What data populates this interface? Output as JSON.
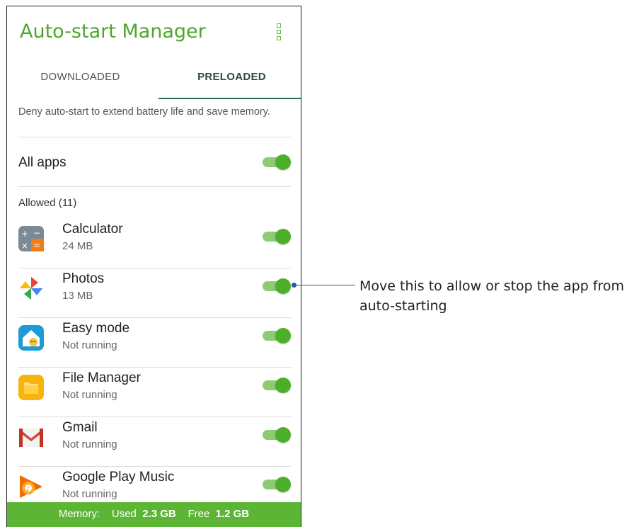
{
  "header": {
    "title": "Auto-start Manager",
    "menu_icon": "overflow-menu-icon"
  },
  "tabs": [
    {
      "label": "DOWNLOADED",
      "selected": false
    },
    {
      "label": "PRELOADED",
      "selected": true
    }
  ],
  "description": "Deny auto-start to extend battery life and save memory.",
  "all_apps": {
    "label": "All apps",
    "enabled": true
  },
  "allowed_section": {
    "label": "Allowed (11)"
  },
  "apps": [
    {
      "name": "Calculator",
      "status": "24 MB",
      "icon": "calculator-icon",
      "enabled": true
    },
    {
      "name": "Photos",
      "status": "13 MB",
      "icon": "photos-pinwheel-icon",
      "enabled": true
    },
    {
      "name": "Easy mode",
      "status": "Not running",
      "icon": "easy-mode-icon",
      "enabled": true
    },
    {
      "name": "File Manager",
      "status": "Not running",
      "icon": "folder-icon",
      "enabled": true
    },
    {
      "name": "Gmail",
      "status": "Not running",
      "icon": "gmail-icon",
      "enabled": true
    },
    {
      "name": "Google Play Music",
      "status": "Not running",
      "icon": "play-music-icon",
      "enabled": true
    }
  ],
  "footer": {
    "memory_label": "Memory:",
    "used_label": "Used",
    "used_value": "2.3 GB",
    "free_label": "Free",
    "free_value": "1.2 GB"
  },
  "callout": {
    "text": "Move this to allow or stop the app from auto-starting"
  },
  "colors": {
    "accent_green": "#4caf2a",
    "callout_blue": "#1a5aa8",
    "footer_green": "#5cb534"
  }
}
